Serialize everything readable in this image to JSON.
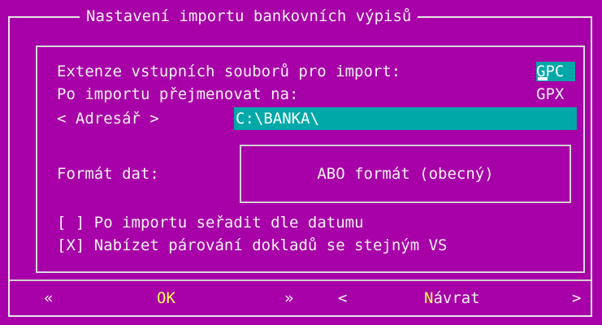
{
  "dialog": {
    "title": "Nastavení importu bankovních výpisů"
  },
  "fields": {
    "extension_label": "Extenze vstupních souborů pro import:",
    "extension_value": "GPC",
    "rename_label": "Po importu přejmenovat na:",
    "rename_value": "GPX",
    "directory_button": "< Adresář >",
    "directory_value": "C:\\BANKA\\"
  },
  "format": {
    "label": "Formát dat:",
    "value": "ABO formát (obecný)"
  },
  "options": [
    {
      "box": "[ ]",
      "label": "Po importu seřadit dle datumu",
      "checked": false
    },
    {
      "box": "[X]",
      "label": "Nabízet párování dokladů se stejným VS",
      "checked": true
    }
  ],
  "buttons": {
    "ok_left": "«",
    "ok_label": "OK",
    "ok_right": "»",
    "back_left": "<",
    "back_hotkey": "N",
    "back_rest": "ávrat",
    "back_right": ">"
  },
  "colors": {
    "background": "#a800a8",
    "field": "#00a8a8",
    "text": "#f2f2f2",
    "hotkey": "#ffff55"
  }
}
